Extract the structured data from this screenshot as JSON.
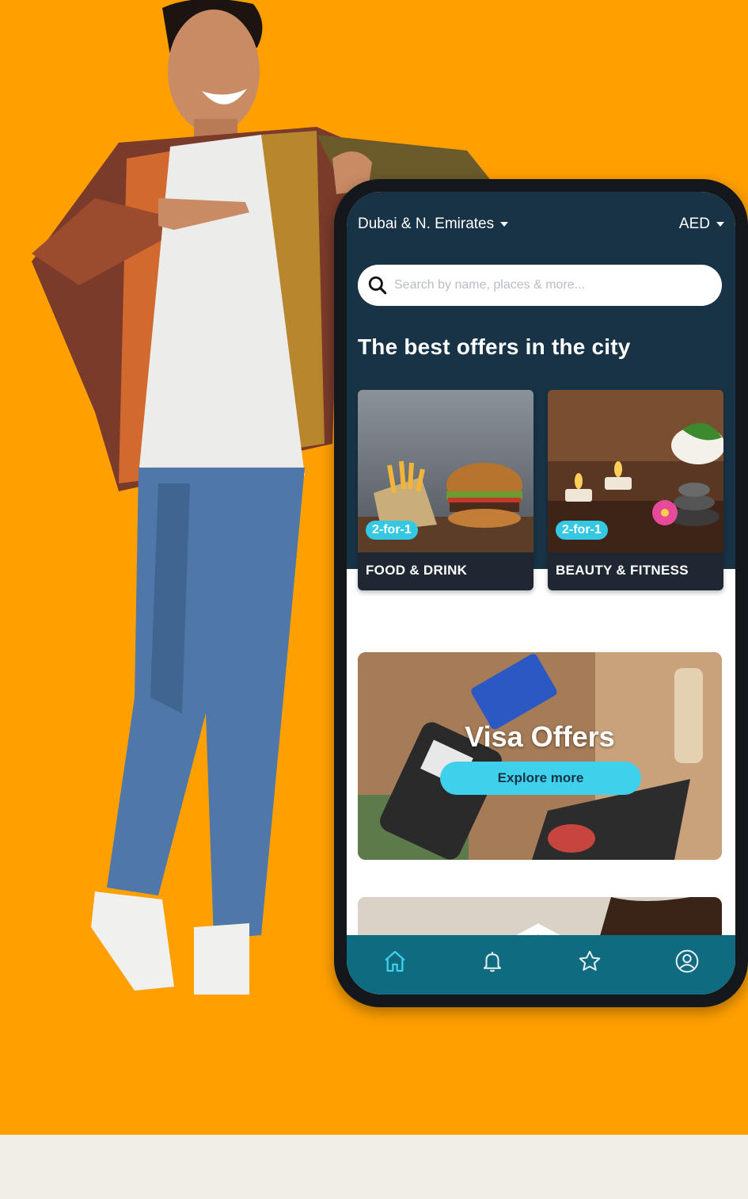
{
  "header": {
    "location": "Dubai & N. Emirates",
    "currency": "AED"
  },
  "search": {
    "placeholder": "Search by name, places & more..."
  },
  "section": {
    "headline": "The best offers in the city"
  },
  "categories": [
    {
      "badge": "2-for-1",
      "label": "FOOD & DRINK"
    },
    {
      "badge": "2-for-1",
      "label": "BEAUTY & FITNESS"
    }
  ],
  "visa_banner": {
    "title": "Visa Offers",
    "button": "Explore more"
  },
  "tabs": [
    {
      "icon": "home-icon"
    },
    {
      "icon": "bell-icon"
    },
    {
      "icon": "star-icon"
    },
    {
      "icon": "profile-icon"
    }
  ],
  "colors": {
    "background": "#ffa000",
    "screen_dark": "#183345",
    "accent": "#34c8e3",
    "tabbar": "#0f6c80"
  }
}
